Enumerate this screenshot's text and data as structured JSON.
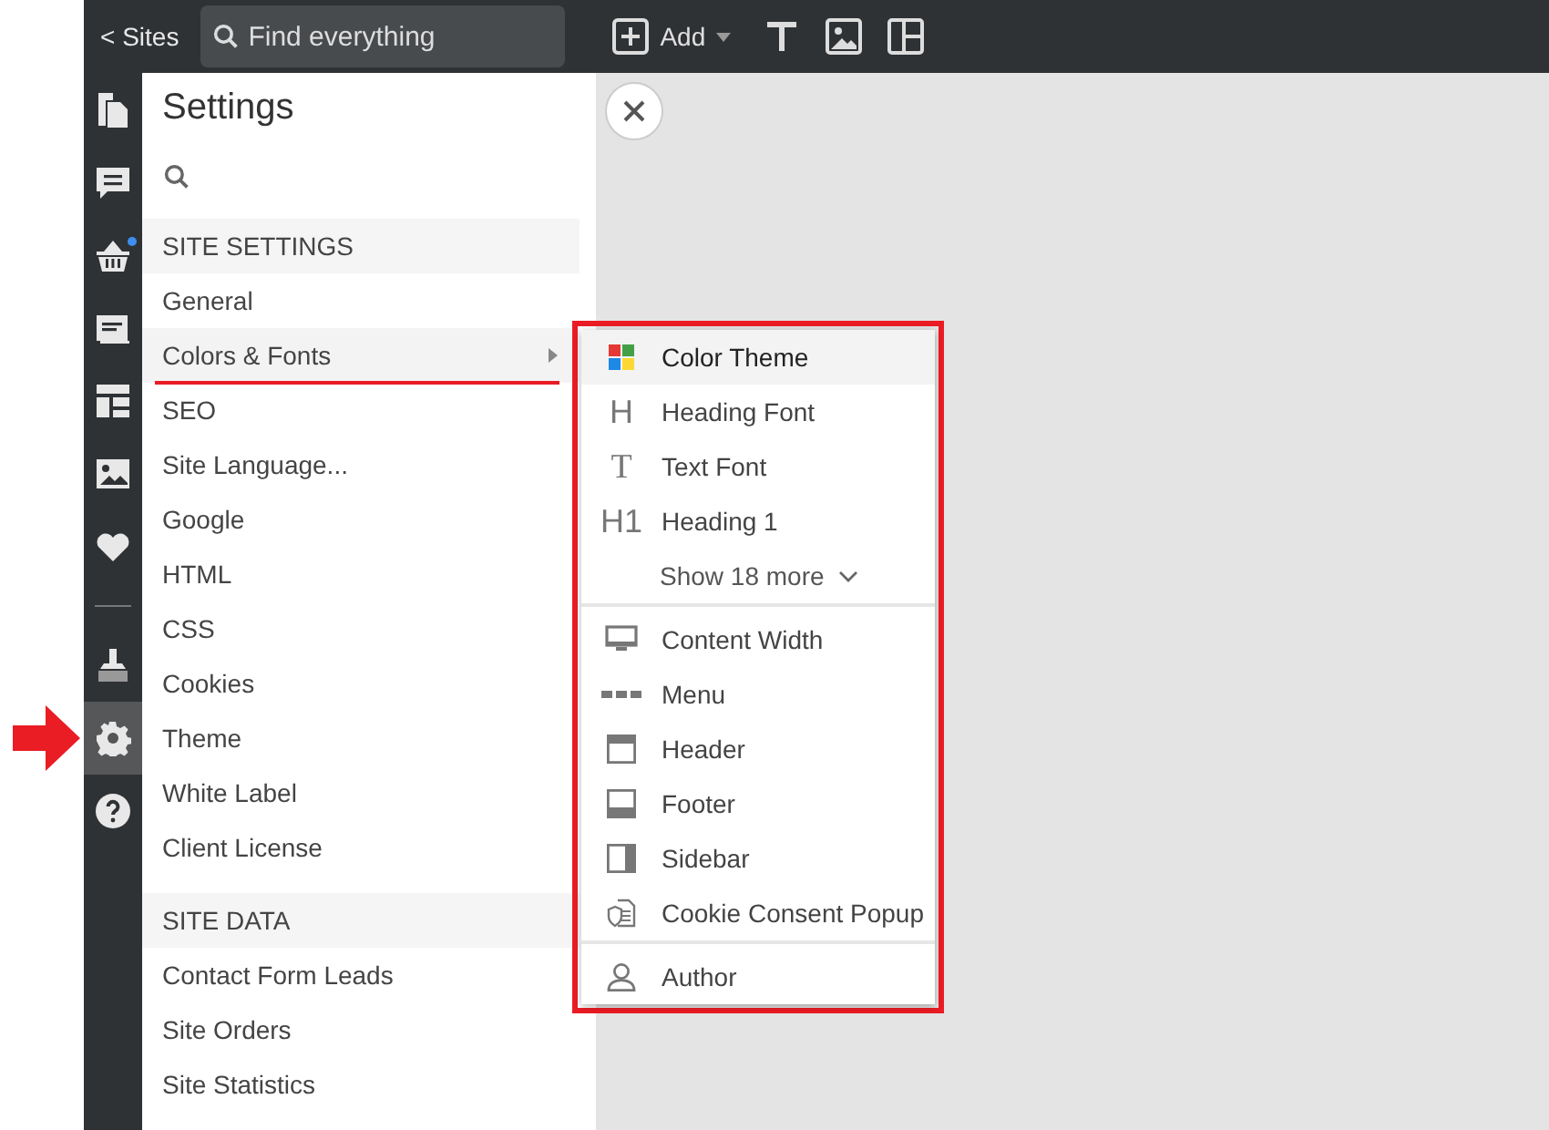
{
  "top_bar": {
    "back_link": "< Sites",
    "search": {
      "placeholder": "Find everything"
    },
    "add_button": "Add"
  },
  "rail": [
    {
      "selected": false,
      "badge": false,
      "annotated": false
    },
    {
      "selected": false,
      "badge": false,
      "annotated": false
    },
    {
      "selected": false,
      "badge": true,
      "annotated": false
    },
    {
      "selected": false,
      "badge": false,
      "annotated": false
    },
    {
      "selected": false,
      "badge": false,
      "annotated": false
    },
    {
      "selected": false,
      "badge": false,
      "annotated": false
    },
    {
      "selected": false,
      "badge": false,
      "annotated": false
    },
    {
      "selected": false,
      "badge": false,
      "annotated": false
    },
    {
      "selected": true,
      "badge": false,
      "annotated": true
    },
    {
      "selected": false,
      "badge": false,
      "annotated": false
    }
  ],
  "settings": {
    "title": "Settings",
    "sections": [
      {
        "header": "SITE SETTINGS",
        "items": [
          {
            "label": "General",
            "selected": false,
            "submenu": false,
            "underlined": false
          },
          {
            "label": "Colors & Fonts",
            "selected": true,
            "submenu": true,
            "underlined": true
          },
          {
            "label": "SEO",
            "selected": false,
            "submenu": false,
            "underlined": false
          },
          {
            "label": "Site Language...",
            "selected": false,
            "submenu": false,
            "underlined": false
          },
          {
            "label": "Google",
            "selected": false,
            "submenu": false,
            "underlined": false
          },
          {
            "label": "HTML",
            "selected": false,
            "submenu": false,
            "underlined": false
          },
          {
            "label": "CSS",
            "selected": false,
            "submenu": false,
            "underlined": false
          },
          {
            "label": "Cookies",
            "selected": false,
            "submenu": false,
            "underlined": false
          },
          {
            "label": "Theme",
            "selected": false,
            "submenu": false,
            "underlined": false
          },
          {
            "label": "White Label",
            "selected": false,
            "submenu": false,
            "underlined": false
          },
          {
            "label": "Client License",
            "selected": false,
            "submenu": false,
            "underlined": false
          }
        ]
      },
      {
        "header": "SITE DATA",
        "items": [
          {
            "label": "Contact Form Leads",
            "selected": false,
            "submenu": false,
            "underlined": false
          },
          {
            "label": "Site Orders",
            "selected": false,
            "submenu": false,
            "underlined": false
          },
          {
            "label": "Site Statistics",
            "selected": false,
            "submenu": false,
            "underlined": false
          }
        ]
      }
    ]
  },
  "submenu": {
    "outlined": true,
    "groups": [
      {
        "items": [
          {
            "label": "Color Theme",
            "selected": true,
            "kind": "palette"
          },
          {
            "label": "Heading Font",
            "selected": false,
            "kind": "glyph",
            "glyph": "H"
          },
          {
            "label": "Text Font",
            "selected": false,
            "kind": "glyph",
            "glyph": "T"
          },
          {
            "label": "Heading 1",
            "selected": false,
            "kind": "glyph",
            "glyph": "H1"
          }
        ],
        "show_more": "Show 18 more"
      },
      {
        "items": [
          {
            "label": "Content Width",
            "selected": false,
            "kind": "monitor"
          },
          {
            "label": "Menu",
            "selected": false,
            "kind": "dashes"
          },
          {
            "label": "Header",
            "selected": false,
            "kind": "header"
          },
          {
            "label": "Footer",
            "selected": false,
            "kind": "footer"
          },
          {
            "label": "Sidebar",
            "selected": false,
            "kind": "sidebar"
          },
          {
            "label": "Cookie Consent Popup",
            "selected": false,
            "kind": "document"
          }
        ]
      },
      {
        "items": [
          {
            "label": "Author",
            "selected": false,
            "kind": "person"
          }
        ]
      }
    ]
  }
}
